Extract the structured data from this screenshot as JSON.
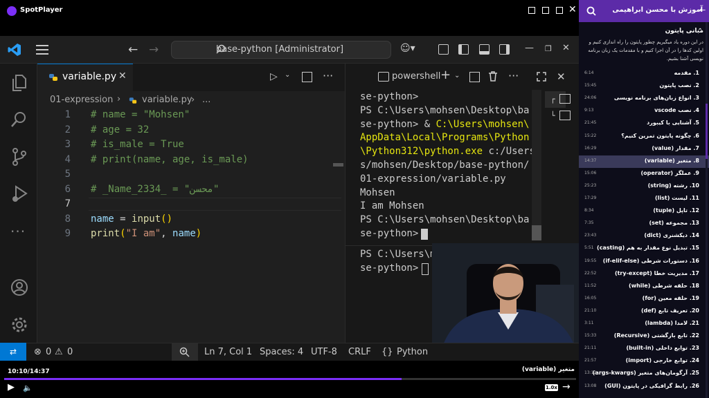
{
  "player": {
    "app_name": "SpotPlayer",
    "time": "10:10/14:37",
    "progress": 0.695,
    "lesson_title": "متغیر (variable)",
    "speed": "1.0x"
  },
  "vscode": {
    "command_center": "base-python [Administrator]",
    "tab_name": "variable.py",
    "breadcrumb": {
      "folder": "01-expression",
      "file": "variable.py",
      "more": "..."
    },
    "code": [
      {
        "n": "1",
        "text": "# name = \"Mohsen\"",
        "type": "comment"
      },
      {
        "n": "2",
        "text": "# age = 32",
        "type": "comment"
      },
      {
        "n": "3",
        "text": "# is_male = True",
        "type": "comment"
      },
      {
        "n": "4",
        "text": "# print(name, age, is_male)",
        "type": "comment"
      },
      {
        "n": "5",
        "text": "",
        "type": "code"
      },
      {
        "n": "6",
        "text": "# _Name_2334_ = \"محسن\"",
        "type": "comment"
      },
      {
        "n": "7",
        "text": "",
        "type": "code"
      },
      {
        "n": "8",
        "text": "name = input()",
        "type": "code"
      },
      {
        "n": "9",
        "text": "print(\"I am\", name)",
        "type": "code"
      }
    ],
    "terminal_title": "powershell",
    "terminal_lines": [
      {
        "text": "se-python>"
      },
      {
        "text": "PS C:\\Users\\mohsen\\Desktop\\ba"
      },
      {
        "pre": "se-python> & ",
        "yellow": "C:\\Users\\mohsen\\"
      },
      {
        "yellow": "AppData\\Local\\Programs\\Python"
      },
      {
        "yellow": "\\Python312\\python.exe",
        "post": " c:/Users"
      },
      {
        "text": "s/mohsen/Desktop/base-python/"
      },
      {
        "text": "01-expression/variable.py"
      },
      {
        "text": "Mohsen"
      },
      {
        "text": "I am Mohsen"
      },
      {
        "text": "PS C:\\Users\\mohsen\\Desktop\\ba"
      },
      {
        "text": "se-python> "
      }
    ],
    "terminal_lines2": [
      {
        "text": "PS C:\\Users\\mohsen\\Desktop\\ba"
      },
      {
        "text": "se-python> "
      }
    ],
    "status": {
      "errors": "0",
      "warnings": "0",
      "position": "Ln 7, Col 1",
      "spaces": "Spaces: 4",
      "encoding": "UTF-8",
      "eol": "CRLF",
      "lang_braces": "{}",
      "language": "Python"
    }
  },
  "sidebar": {
    "header_title": "آموزش با محسن ابراهیمی",
    "section_title": "مبانی پایتون",
    "section_desc": "در این دوره یاد میگیریم چطور پایتون را راه اندازی کنیم و اولین کدها را در آن اجرا کنیم و با مقدمات یک زبان برنامه نویسی آشنا بشیم.",
    "items": [
      {
        "title": "1. مقدمه",
        "dur": "6:14"
      },
      {
        "title": "2. نصب پایتون",
        "dur": "15:45"
      },
      {
        "title": "3. انواع زبان‌های برنامه نویسی",
        "dur": "24:06"
      },
      {
        "title": "4. نصب vscode",
        "dur": "9:13"
      },
      {
        "title": "5. آشنایی با کیبورد",
        "dur": "21:45"
      },
      {
        "title": "6. چگونه پایتون تمرین کنیم؟",
        "dur": "15:22"
      },
      {
        "title": "7. مقدار (value)",
        "dur": "16:29"
      },
      {
        "title": "8. متغیر (variable)",
        "dur": "14:37",
        "active": true
      },
      {
        "title": "9. عملگر (operator)",
        "dur": "15:06"
      },
      {
        "title": "10. رشته (string)",
        "dur": "25:23"
      },
      {
        "title": "11. لیست (list)",
        "dur": "17:29"
      },
      {
        "title": "12. تاپل (tuple)",
        "dur": "8:34"
      },
      {
        "title": "13. مجموعه (set)",
        "dur": "7:35"
      },
      {
        "title": "14. دیکشنری (dict)",
        "dur": "23:43"
      },
      {
        "title": "15. تبدیل نوع مقدار به هم (casting)",
        "dur": "5:51"
      },
      {
        "title": "16. دستورات شرطی (if-elif-else)",
        "dur": "19:55"
      },
      {
        "title": "17. مدیریت خطا (try-except)",
        "dur": "22:52"
      },
      {
        "title": "18. حلقه شرطی (while)",
        "dur": "11:52"
      },
      {
        "title": "19. حلقه معین (for)",
        "dur": "16:05"
      },
      {
        "title": "20. تعریف تابع (def)",
        "dur": "21:10"
      },
      {
        "title": "21. لامدا (lambda)",
        "dur": "3:11"
      },
      {
        "title": "22. تابع بازگشتی (Recursive)",
        "dur": "15:33"
      },
      {
        "title": "23. توابع داخلی (built-in)",
        "dur": "21:11"
      },
      {
        "title": "24. توابع خارجی (import)",
        "dur": "21:57"
      },
      {
        "title": "25. آرگومان‌های متغیر (args-kwargs)",
        "dur": "13:12"
      },
      {
        "title": "26. رابط گرافیکی در پایتون (GUI)",
        "dur": "13:08"
      }
    ]
  }
}
